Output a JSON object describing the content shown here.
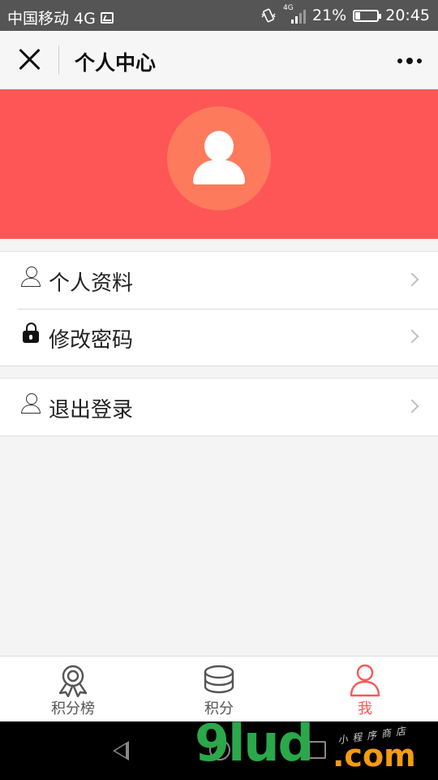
{
  "status_bar": {
    "carrier": "中国移动 4G",
    "net_badge": "4G",
    "battery_percent": "21%",
    "battery_level": 0.21,
    "time": "20:45"
  },
  "nav": {
    "title": "个人中心"
  },
  "menu_groups": [
    {
      "items": [
        {
          "label": "个人资料",
          "icon": "user-icon"
        },
        {
          "label": "修改密码",
          "icon": "lock-icon"
        }
      ]
    },
    {
      "items": [
        {
          "label": "退出登录",
          "icon": "user-icon"
        }
      ]
    }
  ],
  "tabbar": {
    "tabs": [
      {
        "label": "积分榜",
        "icon": "award-icon",
        "active": false
      },
      {
        "label": "积分",
        "icon": "coins-icon",
        "active": false
      },
      {
        "label": "我",
        "icon": "user-icon",
        "active": true
      }
    ]
  },
  "watermark": {
    "brand": "9lud",
    "suffix": ".com",
    "tagline": "小程序商店"
  },
  "colors": {
    "accent": "#fe5656",
    "avatar_bg": "#fe7a5c",
    "watermark_green": "#2aa84a",
    "watermark_orange": "#f39c12"
  }
}
